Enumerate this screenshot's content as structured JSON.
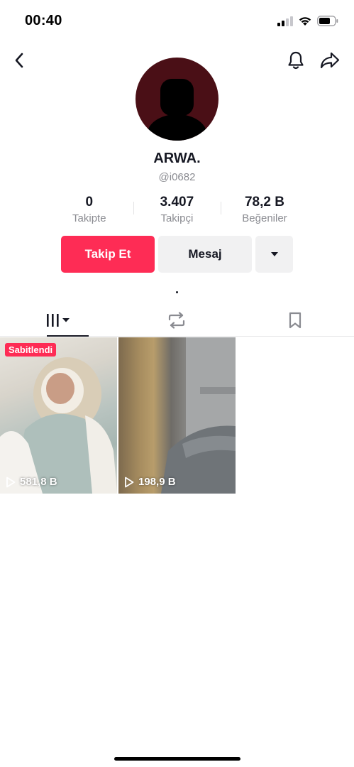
{
  "status_bar": {
    "time": "00:40"
  },
  "profile": {
    "username": "ARWA.",
    "handle": "@i0682",
    "avatar_color": "#4a0f16"
  },
  "stats": [
    {
      "value": "0",
      "label": "Takipte"
    },
    {
      "value": "3.407",
      "label": "Takipçi"
    },
    {
      "value": "78,2 B",
      "label": "Beğeniler"
    }
  ],
  "actions": {
    "follow_label": "Takip Et",
    "message_label": "Mesaj",
    "accent_color": "#fe2c55"
  },
  "tabs": [
    {
      "icon": "grid-icon",
      "active": true
    },
    {
      "icon": "repost-icon",
      "active": false
    },
    {
      "icon": "bookmark-icon",
      "active": false
    }
  ],
  "videos": [
    {
      "pinned_label": "Sabitlendi",
      "views": "581,8 B"
    },
    {
      "views": "198,9 B"
    }
  ]
}
